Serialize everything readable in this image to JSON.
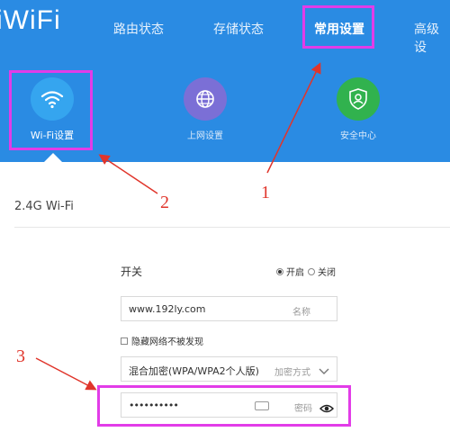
{
  "header": {
    "logo": "iWiFi",
    "nav": [
      "路由状态",
      "存储状态",
      "常用设置",
      "高级设"
    ],
    "active_nav": "常用设置"
  },
  "subnav": [
    {
      "label": "Wi-Fi设置",
      "icon": "wifi-icon",
      "color": "#35a5ef",
      "active": true
    },
    {
      "label": "上网设置",
      "icon": "globe-icon",
      "color": "#7b6fd6",
      "active": false
    },
    {
      "label": "安全中心",
      "icon": "shield-user-icon",
      "color": "#31b24e",
      "active": false
    }
  ],
  "annotations": {
    "n1": "1",
    "n2": "2",
    "n3": "3",
    "highlight_color": "#e23ce8",
    "arrow_color": "#e0352b"
  },
  "content": {
    "section_title": "2.4G Wi-Fi",
    "switch_label": "开关",
    "on_label": "开启",
    "off_label": "关闭",
    "switch_value": "on",
    "ssid_value": "www.192ly.com",
    "ssid_placeholder": "名称",
    "hidden_label": "隐藏网络不被发现",
    "encryption_value": "混合加密(WPA/WPA2个人版)",
    "encryption_placeholder": "加密方式",
    "password_value": "••••••••••",
    "password_placeholder": "密码"
  },
  "colors": {
    "header_bg": "#2a8be3"
  }
}
